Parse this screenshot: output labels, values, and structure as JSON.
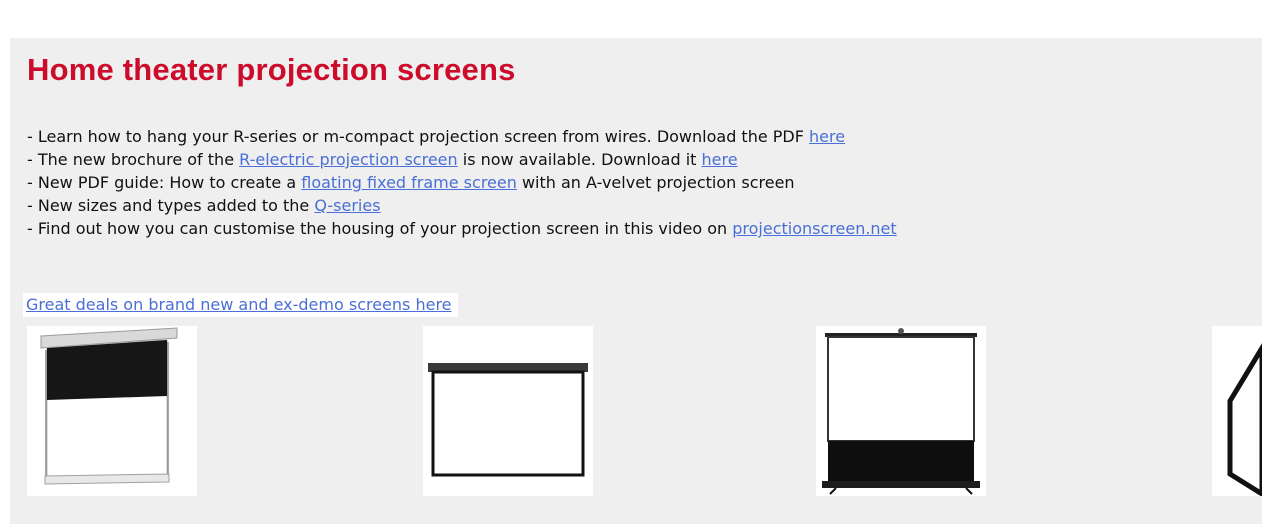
{
  "title": "Home theater projection screens",
  "news": [
    {
      "prefix": "- Learn how to hang your R-series or m-compact projection screen from wires. Download the PDF ",
      "link1": "here",
      "middle": "",
      "link2": "",
      "suffix": ""
    },
    {
      "prefix": "- The new brochure of the ",
      "link1": "R-electric projection screen",
      "middle": " is now available. Download it ",
      "link2": "here",
      "suffix": ""
    },
    {
      "prefix": "- New PDF guide: How to create a ",
      "link1": "floating fixed frame screen",
      "middle": " with an A-velvet projection screen",
      "link2": "",
      "suffix": ""
    },
    {
      "prefix": "- New sizes and types added to the ",
      "link1": "Q-series",
      "middle": "",
      "link2": "",
      "suffix": ""
    },
    {
      "prefix": "- Find out how you can customise the housing of your projection screen in this video on ",
      "link1": "projectionscreen.net",
      "middle": "",
      "link2": "",
      "suffix": ""
    }
  ],
  "deals_link": "Great deals on brand new and ex-demo screens here",
  "products": [
    {
      "icon": "tensioned-electric-screen-icon"
    },
    {
      "icon": "wall-mounted-screen-icon"
    },
    {
      "icon": "portable-floor-screen-icon"
    },
    {
      "icon": "frame-screen-icon"
    }
  ],
  "colors": {
    "title": "#cc0c2a",
    "link": "#4a6fd6",
    "panel": "#efefef"
  }
}
